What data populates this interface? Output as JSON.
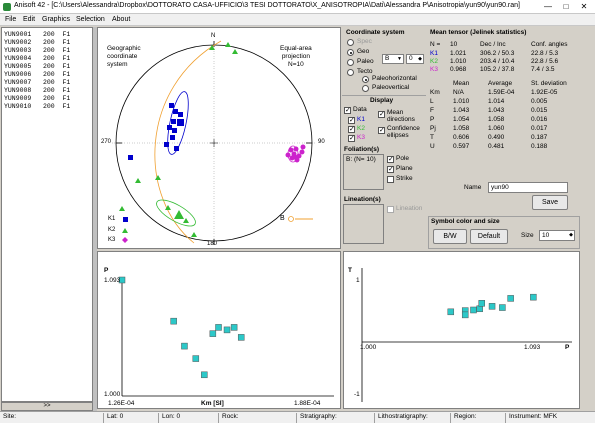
{
  "window": {
    "title": "Anisoft 42 - [C:\\Users\\Alessandra\\Dropbox\\DOTTORATO CASA-UFFICIO\\3 TESI DOTTORATO\\X_ANISOTROPIA\\Dati\\Alessandra P\\Anisotropia\\yun90\\yun90.ran]",
    "minimize": "—",
    "maximize": "□",
    "close": "✕"
  },
  "menu": [
    "File",
    "Edit",
    "Graphics",
    "Selection",
    "About"
  ],
  "list": {
    "rows": [
      "YUN9001   200  F1",
      "YUN9002   200  F1",
      "YUN9003   200  F1",
      "YUN9004   200  F1",
      "YUN9005   200  F1",
      "YUN9006   200  F1",
      "YUN9007   200  F1",
      "YUN9008   200  F1",
      "YUN9009   200  F1",
      "YUN9010   200  F1"
    ],
    "scroll_label": ">>"
  },
  "stereonet": {
    "label_left": "Geographic\ncoordinate\nsystem",
    "label_right": "Equal-area\nprojection\nN=10",
    "north": "N",
    "east": "90",
    "west": "270",
    "south": "180",
    "legend": [
      "K1",
      "K2",
      "K3"
    ],
    "b_label": "B"
  },
  "coord": {
    "title": "Coordinate system",
    "spec": "Spec",
    "geo": "Geo",
    "paleo": "Paleo",
    "tecto": "Tecto",
    "paleo_value": "B",
    "paleo_num": "0",
    "paleohorizontal": "Paleohorizontal",
    "paleovertical": "Paleovertical"
  },
  "display": {
    "title": "Display",
    "data": "Data",
    "k1": "K1",
    "k2": "K2",
    "k3": "K3",
    "mean_directions": "Mean\ndirections",
    "confidence_ellipses": "Confidence\nellipses",
    "foliation_title": "Foliation(s)",
    "foliation_item": "B: (N= 10)",
    "pole": "Pole",
    "plane": "Plane",
    "strike": "Strike",
    "lineation_title": "Lineation(s)",
    "lineation_chk": "Lineation"
  },
  "tensor": {
    "title": "Mean tensor (Jelinek statistics)",
    "n_label": "N =",
    "n_value": "10",
    "headers": [
      "",
      "",
      "Dec / Inc",
      "Conf. angles"
    ],
    "rows": [
      {
        "label": "K1",
        "value": "1.021",
        "dec": "306.2 / 50.3",
        "conf": "22.8 / 5.3"
      },
      {
        "label": "K2",
        "value": "1.010",
        "dec": "203.4 / 10.4",
        "conf": "22.8 / 5.6"
      },
      {
        "label": "K3",
        "value": "0.968",
        "dec": "105.2 / 37.8",
        "conf": "7.4 / 3.5"
      }
    ],
    "stats_headers": [
      "",
      "Mean",
      "Average",
      "St. deviation"
    ],
    "stats": [
      {
        "label": "Km",
        "mean": "N/A",
        "avg": "1.59E-04",
        "sd": "1.92E-05"
      },
      {
        "label": "L",
        "mean": "1.010",
        "avg": "1.014",
        "sd": "0.005"
      },
      {
        "label": "F",
        "mean": "1.043",
        "avg": "1.043",
        "sd": "0.015"
      },
      {
        "label": "P",
        "mean": "1.054",
        "avg": "1.058",
        "sd": "0.016"
      },
      {
        "label": "Pj",
        "mean": "1.058",
        "avg": "1.060",
        "sd": "0.017"
      },
      {
        "label": "T",
        "mean": "0.606",
        "avg": "0.490",
        "sd": "0.187"
      },
      {
        "label": "U",
        "mean": "0.597",
        "avg": "0.481",
        "sd": "0.188"
      }
    ],
    "name_label": "Name",
    "name_value": "yun90",
    "save": "Save"
  },
  "symbol": {
    "title": "Symbol color and size",
    "bw": "B/W",
    "default": "Default",
    "size_label": "Size",
    "size_value": "10"
  },
  "colors": {
    "k1": "#0000cc",
    "k2": "#33bb33",
    "k3": "#cc22cc",
    "cyan": "#2cc8c8",
    "orange": "#f0a030"
  },
  "chart_data": [
    {
      "type": "scatter",
      "ylabel": "P",
      "xlabel": "Km [SI]",
      "xlim_labels": [
        "1.26E-04",
        "1.88E-04"
      ],
      "ylim_labels": [
        "1.000",
        "1.093"
      ],
      "xlim": [
        0.000126,
        0.000188
      ],
      "ylim": [
        1.0,
        1.093
      ],
      "points": [
        [
          0.000126,
          1.093
        ],
        [
          0.0001442,
          1.06
        ],
        [
          0.000148,
          1.04
        ],
        [
          0.000152,
          1.03
        ],
        [
          0.000155,
          1.017
        ],
        [
          0.000158,
          1.05
        ],
        [
          0.00016,
          1.055
        ],
        [
          0.000163,
          1.053
        ],
        [
          0.0001655,
          1.055
        ],
        [
          0.000168,
          1.047
        ]
      ]
    },
    {
      "type": "scatter",
      "ylabel": "T",
      "xlabel": "P",
      "xlim_labels": [
        "1.000",
        "1.093"
      ],
      "ylim_labels": [
        "1",
        "-1"
      ],
      "xlim": [
        1.0,
        1.093
      ],
      "ylim": [
        -1,
        1
      ],
      "points": [
        [
          1.043,
          0.38
        ],
        [
          1.05,
          0.4
        ],
        [
          1.054,
          0.41
        ],
        [
          1.057,
          0.43
        ],
        [
          1.063,
          0.47
        ],
        [
          1.068,
          0.45
        ],
        [
          1.058,
          0.52
        ],
        [
          1.083,
          0.62
        ],
        [
          1.072,
          0.6
        ],
        [
          1.05,
          0.33
        ]
      ]
    }
  ],
  "status": {
    "site": "Site:",
    "lat": "Lat: 0",
    "lon": "Lon: 0",
    "rock": "Rock:",
    "strat": "Stratigraphy:",
    "litho": "Lithostratigraphy:",
    "region": "Region:",
    "instrument": "Instrument: MFK"
  }
}
